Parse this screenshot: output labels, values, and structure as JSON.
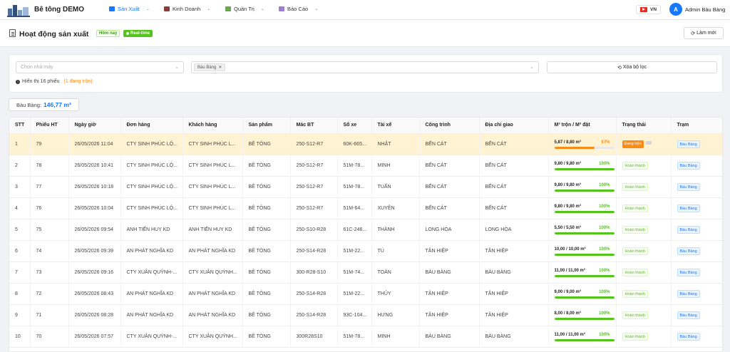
{
  "app": {
    "brand": "Bê tông DEMO",
    "accent": "#1677ff"
  },
  "nav": [
    {
      "label": "Sản Xuất",
      "icon": "factory-icon",
      "active": true
    },
    {
      "label": "Kinh Doanh",
      "icon": "briefcase-icon",
      "active": false
    },
    {
      "label": "Quản Trị",
      "icon": "admin-icon",
      "active": false
    },
    {
      "label": "Báo Cáo",
      "icon": "report-icon",
      "active": false
    }
  ],
  "header_right": {
    "lang": "VN",
    "avatar_letter": "A",
    "user_name": "Admin Bàu Bàng"
  },
  "page": {
    "title": "Hoạt động sản xuất",
    "tag_today": "Hôm nay",
    "tag_realtime": "Real-time",
    "refresh_label": "Làm mới"
  },
  "filters": {
    "plant_placeholder": "Chọn nhà máy",
    "selected_chip": "Bàu Bàng",
    "clear_label": "Xóa bộ lọc",
    "info_text": "Hiển thị 16 phiếu",
    "mixing_text": "(1 đang trộn)"
  },
  "summary": {
    "label": "Bàu Bàng:",
    "value": "146,77 m³"
  },
  "table": {
    "columns": [
      "STT",
      "Phiếu HT",
      "Ngày giờ",
      "Đơn hàng",
      "Khách hàng",
      "Sản phẩm",
      "Mác BT",
      "Số xe",
      "Tài xế",
      "Công trình",
      "Địa chỉ giao",
      "M³ trộn / M³ đặt",
      "Trạng thái",
      "Trạm"
    ],
    "rows": [
      {
        "stt": "1",
        "phieu": "79",
        "time": "26/05/2026 11:04",
        "order": "CTY SINH PHÚC LỘ...",
        "customer": "CTY SINH PHÚC L...",
        "product": "BÊ TÔNG",
        "grade": "250-S12-R7",
        "truck": "60K-665...",
        "driver": "NHẬT",
        "site": "BẾN CÁT",
        "address": "BẾN CÁT",
        "volume": "5,87 / 8,80 m³",
        "pct": "67%",
        "pct_value": 67,
        "status": "Đang trộn",
        "mixing": true,
        "station": "Bàu Bàng"
      },
      {
        "stt": "2",
        "phieu": "78",
        "time": "26/05/2026 10:41",
        "order": "CTY SINH PHÚC LỘ...",
        "customer": "CTY SINH PHÚC L...",
        "product": "BÊ TÔNG",
        "grade": "250-S12-R7",
        "truck": "51M-78...",
        "driver": "MINH",
        "site": "BẾN CÁT",
        "address": "BẾN CÁT",
        "volume": "9,80 / 9,80 m³",
        "pct": "100%",
        "pct_value": 100,
        "status": "Hoàn thành",
        "mixing": false,
        "station": "Bàu Bàng"
      },
      {
        "stt": "3",
        "phieu": "77",
        "time": "26/05/2026 10:18",
        "order": "CTY SINH PHÚC LỘ...",
        "customer": "CTY SINH PHÚC L...",
        "product": "BÊ TÔNG",
        "grade": "250-S12-R7",
        "truck": "51M-78...",
        "driver": "TUẤN",
        "site": "BẾN CÁT",
        "address": "BẾN CÁT",
        "volume": "9,80 / 9,80 m³",
        "pct": "100%",
        "pct_value": 100,
        "status": "Hoàn thành",
        "mixing": false,
        "station": "Bàu Bàng"
      },
      {
        "stt": "4",
        "phieu": "76",
        "time": "26/05/2026 10:04",
        "order": "CTY SINH PHÚC LỘ...",
        "customer": "CTY SINH PHÚC L...",
        "product": "BÊ TÔNG",
        "grade": "250-S12-R7",
        "truck": "51M-64...",
        "driver": "XUYÊN",
        "site": "BẾN CÁT",
        "address": "BẾN CÁT",
        "volume": "9,80 / 9,80 m³",
        "pct": "100%",
        "pct_value": 100,
        "status": "Hoàn thành",
        "mixing": false,
        "station": "Bàu Bàng"
      },
      {
        "stt": "5",
        "phieu": "75",
        "time": "26/05/2026 09:54",
        "order": "ANH TIẾN HUY KD",
        "customer": "ANH TIẾN HUY KD",
        "product": "BÊ TÔNG",
        "grade": "250-S10-R28",
        "truck": "61C-246...",
        "driver": "THÀNH",
        "site": "LONG HÒA",
        "address": "LONG HÒA",
        "volume": "5,50 / 5,50 m³",
        "pct": "100%",
        "pct_value": 100,
        "status": "Hoàn thành",
        "mixing": false,
        "station": "Bàu Bàng"
      },
      {
        "stt": "6",
        "phieu": "74",
        "time": "26/05/2026 09:39",
        "order": "AN PHÁT NGHĨA KD",
        "customer": "AN PHÁT NGHĨA KD",
        "product": "BÊ TÔNG",
        "grade": "250-S14-R28",
        "truck": "51M-22...",
        "driver": "TÚ",
        "site": "TÂN HIỆP",
        "address": "TÂN HIỆP",
        "volume": "10,00 / 10,00 m³",
        "pct": "100%",
        "pct_value": 100,
        "status": "Hoàn thành",
        "mixing": false,
        "station": "Bàu Bàng"
      },
      {
        "stt": "7",
        "phieu": "73",
        "time": "26/05/2026 09:16",
        "order": "CTY XUÂN QUỲNH-...",
        "customer": "CTY XUÂN QUỲNH...",
        "product": "BÊ TÔNG",
        "grade": "300-R28-S10",
        "truck": "51M-74...",
        "driver": "TOÀN",
        "site": "BÀU BÀNG",
        "address": "BÀU BÀNG",
        "volume": "11,00 / 11,00 m³",
        "pct": "100%",
        "pct_value": 100,
        "status": "Hoàn thành",
        "mixing": false,
        "station": "Bàu Bàng"
      },
      {
        "stt": "8",
        "phieu": "72",
        "time": "26/05/2026 08:43",
        "order": "AN PHÁT NGHĨA KD",
        "customer": "AN PHÁT NGHĨA KD",
        "product": "BÊ TÔNG",
        "grade": "250-S14-R28",
        "truck": "51M-22...",
        "driver": "THỦY",
        "site": "TÂN HIỆP",
        "address": "TÂN HIỆP",
        "volume": "9,00 / 9,00 m³",
        "pct": "100%",
        "pct_value": 100,
        "status": "Hoàn thành",
        "mixing": false,
        "station": "Bàu Bàng"
      },
      {
        "stt": "9",
        "phieu": "71",
        "time": "26/05/2026 08:28",
        "order": "AN PHÁT NGHĨA KD",
        "customer": "AN PHÁT NGHĨA KD",
        "product": "BÊ TÔNG",
        "grade": "250-S14-R28",
        "truck": "93C-104...",
        "driver": "HƯNG",
        "site": "TÂN HIỆP",
        "address": "TÂN HIỆP",
        "volume": "8,00 / 8,00 m³",
        "pct": "100%",
        "pct_value": 100,
        "status": "Hoàn thành",
        "mixing": false,
        "station": "Bàu Bàng"
      },
      {
        "stt": "10",
        "phieu": "70",
        "time": "26/05/2026 07:57",
        "order": "CTY XUÂN QUỲNH-...",
        "customer": "CTY XUÂN QUỲNH...",
        "product": "BÊ TÔNG",
        "grade": "300R28S10",
        "truck": "51M-78...",
        "driver": "MINH",
        "site": "BÀU BÀNG",
        "address": "BÀU BÀNG",
        "volume": "11,00 / 11,00 m³",
        "pct": "100%",
        "pct_value": 100,
        "status": "Hoàn thành",
        "mixing": false,
        "station": "Bàu Bàng"
      }
    ]
  }
}
